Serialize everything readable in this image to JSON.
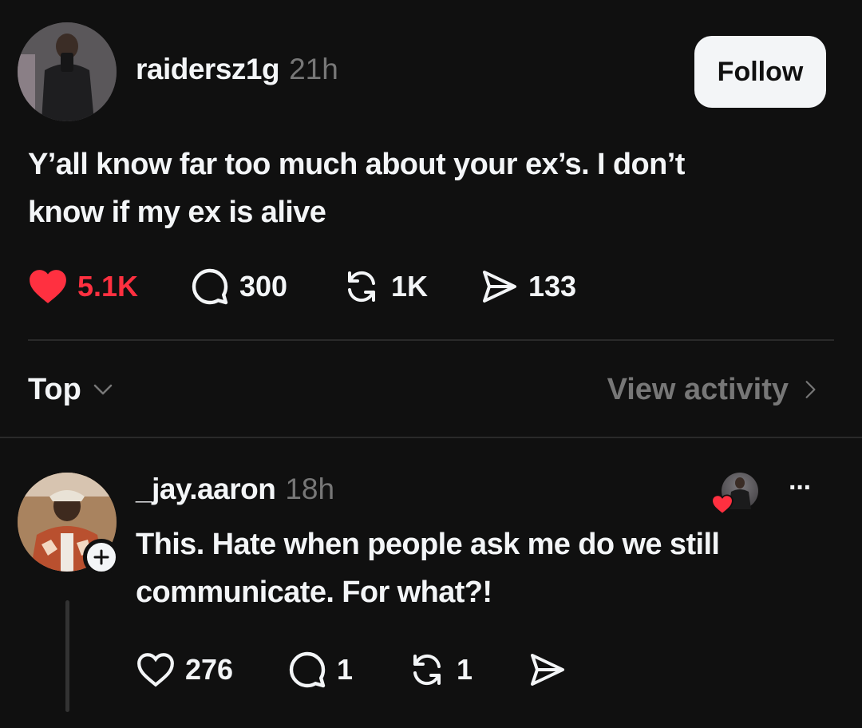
{
  "post": {
    "username": "raidersz1g",
    "time": "21h",
    "follow_label": "Follow",
    "text_line1": "Y’all know far too much about your ex’s. I don’t",
    "text_line2": "know if my ex is alive",
    "likes": "5.1K",
    "replies": "300",
    "reposts": "1K",
    "shares": "133",
    "like_color": "#ff3040"
  },
  "filter": {
    "sort_label": "Top",
    "activity_label": "View activity"
  },
  "reply": {
    "username": "_jay.aaron",
    "time": "18h",
    "text_line1": "This. Hate when people ask me do we still",
    "text_line2": "communicate. For what?!",
    "likes": "276",
    "replies": "1",
    "reposts": "1",
    "more_label": "···"
  }
}
